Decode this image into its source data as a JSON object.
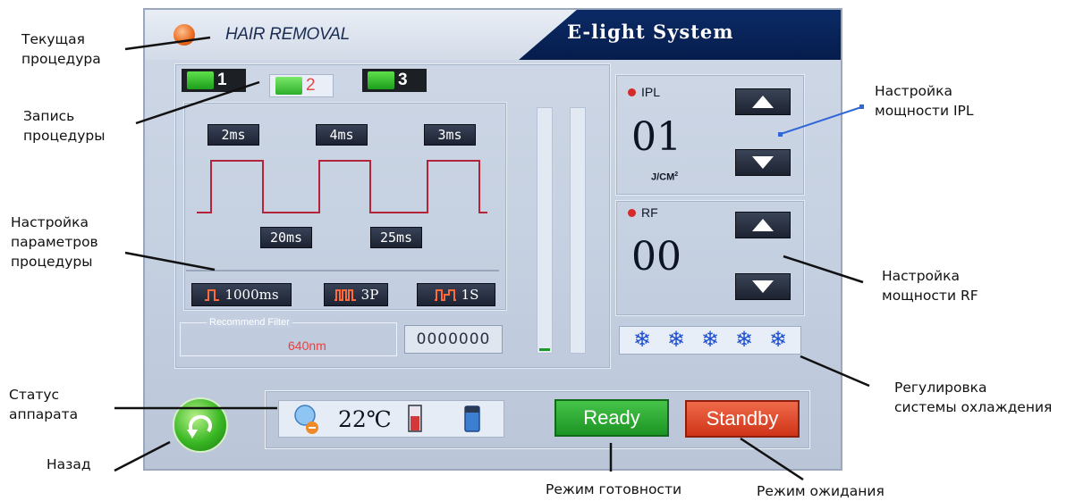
{
  "screen": {
    "mode_title": "HAIR REMOVAL",
    "system_title": "E-light  System",
    "tabs": [
      {
        "label": "1",
        "active": false
      },
      {
        "label": "2",
        "active": true
      },
      {
        "label": "3",
        "active": false
      }
    ],
    "pulse_widths": [
      "2ms",
      "4ms",
      "3ms"
    ],
    "pulse_delays": [
      "20ms",
      "25ms"
    ],
    "settings": {
      "interval": "1000ms",
      "pulses": "3P",
      "repeat": "1S"
    },
    "filter": {
      "label": "Recommend Filter",
      "value": "640nm"
    },
    "counter": "0000000",
    "ipl": {
      "label": "IPL",
      "value": "01",
      "unit": "J/CM",
      "unit_sup": "2"
    },
    "rf": {
      "label": "RF",
      "value": "00"
    },
    "cooling_level": 5,
    "temperature": "22℃",
    "ready_label": "Ready",
    "standby_label": "Standby"
  },
  "callouts": {
    "current_procedure": [
      "Текущая",
      "процедура"
    ],
    "procedure_record": [
      "Запись",
      "процедуры"
    ],
    "parameter_setup": [
      "Настройка",
      "параметров",
      "процедуры"
    ],
    "device_status": [
      "Статус",
      "аппарата"
    ],
    "back": [
      "Назад"
    ],
    "ipl_power": [
      "Настройка",
      "мощности IPL"
    ],
    "rf_power": [
      "Настройка",
      "мощности RF"
    ],
    "cooling": [
      "Регулировка",
      "системы охлаждения"
    ],
    "ready_mode": [
      "Режим готовности"
    ],
    "standby_mode": [
      "Режим ожидания"
    ]
  },
  "colors": {
    "accent_ready": "#1c9424",
    "accent_standby": "#cf3418",
    "value_red": "#e94040",
    "header_dark": "#0b2a66"
  }
}
